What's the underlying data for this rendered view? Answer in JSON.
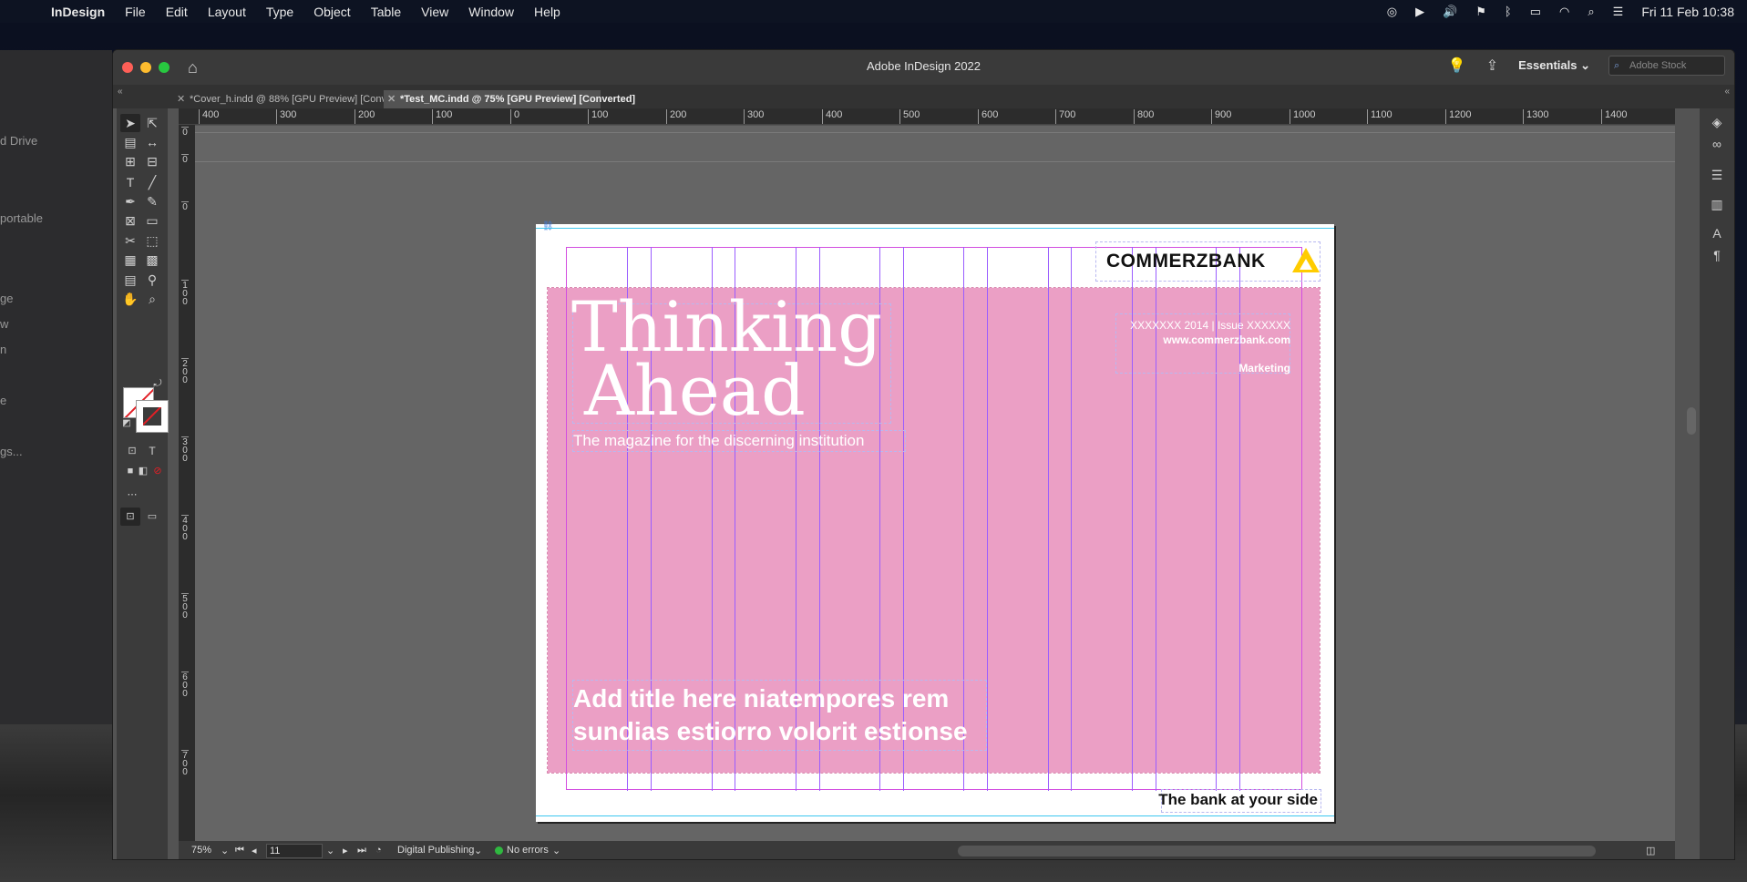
{
  "menubar": {
    "apple": "",
    "items": [
      "InDesign",
      "File",
      "Edit",
      "Layout",
      "Type",
      "Object",
      "Table",
      "View",
      "Window",
      "Help"
    ],
    "clock": "Fri 11 Feb  10:38"
  },
  "finder_sidebar": {
    "items": [
      "d Drive",
      "portable",
      "ge",
      "w",
      "n",
      "e",
      "gs..."
    ]
  },
  "window": {
    "title": "Adobe InDesign 2022",
    "workspace": "Essentials",
    "stock_placeholder": "Adobe Stock"
  },
  "tabs": [
    {
      "label": "*Cover_h.indd @ 88% [GPU Preview] [Converted]",
      "active": false
    },
    {
      "label": "*Test_MC.indd @ 75% [GPU Preview] [Converted]",
      "active": true
    }
  ],
  "hruler": [
    "400",
    "300",
    "200",
    "100",
    "0",
    "100",
    "200",
    "300",
    "400",
    "500",
    "600",
    "700",
    "800",
    "900",
    "1000",
    "1100",
    "1200",
    "1300",
    "1400"
  ],
  "vruler": [
    "0",
    "0",
    "0",
    "100",
    "200",
    "300",
    "400",
    "500",
    "600",
    "700"
  ],
  "document": {
    "logo": "COMMERZBANK",
    "title_line1": "Thinking",
    "title_line2": "Ahead",
    "tagline": "The magazine for the discerning institution",
    "issue": "XXXXXXX 2014  |  Issue XXXXXX",
    "website": "www.commerzbank.com",
    "department": "Marketing",
    "headline_line1": "Add title here niatempores rem",
    "headline_line2": "sundias estiorro volorit estionse",
    "strapline": "The bank at your side",
    "colors": {
      "pink": "#eb9fc5",
      "logo_yellow": "#ffcc00",
      "margin_guide": "#d24ee0",
      "column_guide": "#9a5dff"
    }
  },
  "statusbar": {
    "zoom": "75%",
    "page": "11",
    "intent": "Digital Publishing",
    "preflight": "No errors"
  }
}
